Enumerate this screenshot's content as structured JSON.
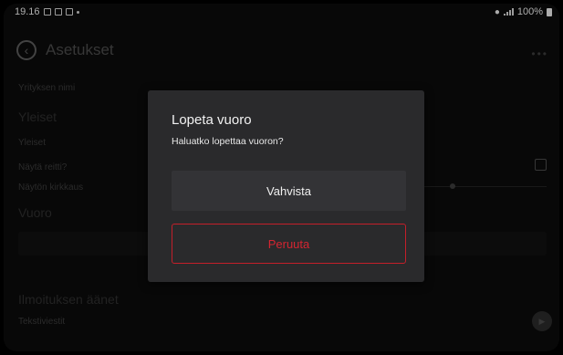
{
  "status_bar": {
    "time": "19.16",
    "right_text": "100%"
  },
  "settings_page": {
    "title": "Asetukset",
    "rows": {
      "company_name_label": "Yrityksen nimi",
      "general_section": "Yleiset",
      "general_label": "Yleiset",
      "show_route_label": "Näytä reitti?",
      "screen_brightness_label": "Näytön kirkkaus",
      "shift_section": "Vuoro",
      "notification_sounds_section": "Ilmoituksen äänet",
      "text_message_label": "Tekstiviestit"
    }
  },
  "dialog": {
    "title": "Lopeta vuoro",
    "message": "Haluatko lopettaa vuoron?",
    "confirm_label": "Vahvista",
    "cancel_label": "Peruuta"
  },
  "colors": {
    "dialog_background": "#2a2a2c",
    "confirm_button": "#333336",
    "cancel_accent": "#c41f2a"
  }
}
